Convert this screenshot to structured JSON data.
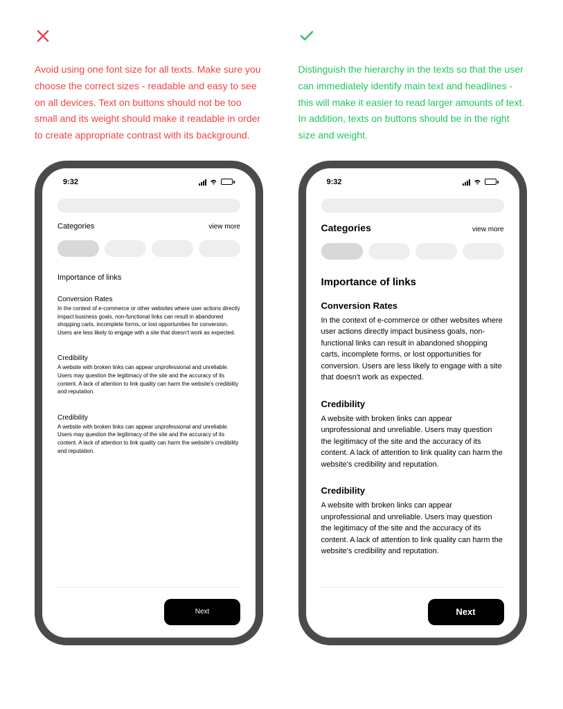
{
  "bad": {
    "description": "Avoid using one font size for all texts. Make sure you choose the correct sizes - readable and easy to see on all devices. Text on buttons should not be too small and its weight should make it readable in order to create appropriate contrast with its background."
  },
  "good": {
    "description": "Distinguish the hierarchy in the texts so that the user can immediately identify main text and headlines - this will make it easier to read larger amounts of text. In addition, texts on buttons should be in the right size and weight."
  },
  "phone": {
    "time": "9:32",
    "categories_label": "Categories",
    "view_more": "view more",
    "section_title": "Importance of links",
    "blocks": [
      {
        "heading": "Conversion Rates",
        "body": "In the context of e-commerce or other websites where user actions directly impact business goals, non-functional links can result in abandoned shopping carts, incomplete forms, or lost opportunities for conversion. Users are less likely to engage with a site that doesn't work as expected."
      },
      {
        "heading": "Credibility",
        "body": "A website with broken links can appear unprofessional and unreliable. Users may question the legitimacy of the site and the accuracy of its content. A lack of attention to link quality can harm the website's credibility and reputation."
      },
      {
        "heading": "Credibility",
        "body": "A website with broken links can appear unprofessional and unreliable. Users may question the legitimacy of the site and the accuracy of its content. A lack of attention to link quality can harm the website's credibility and reputation."
      }
    ],
    "next_label": "Next"
  }
}
